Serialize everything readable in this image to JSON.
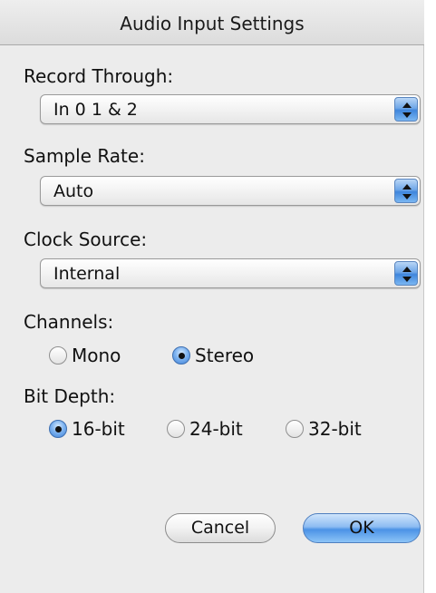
{
  "window": {
    "title": "Audio Input Settings"
  },
  "record_through": {
    "label": "Record Through:",
    "value": "In 0 1 & 2"
  },
  "sample_rate": {
    "label": "Sample Rate:",
    "value": "Auto"
  },
  "clock_source": {
    "label": "Clock Source:",
    "value": "Internal"
  },
  "channels": {
    "label": "Channels:",
    "options": [
      {
        "label": "Mono",
        "selected": false
      },
      {
        "label": "Stereo",
        "selected": true
      }
    ]
  },
  "bit_depth": {
    "label": "Bit Depth:",
    "options": [
      {
        "label": "16-bit",
        "selected": true
      },
      {
        "label": "24-bit",
        "selected": false
      },
      {
        "label": "32-bit",
        "selected": false
      }
    ]
  },
  "buttons": {
    "cancel": "Cancel",
    "ok": "OK"
  },
  "colors": {
    "accent": "#3f86dc",
    "window_bg": "#ececec"
  }
}
